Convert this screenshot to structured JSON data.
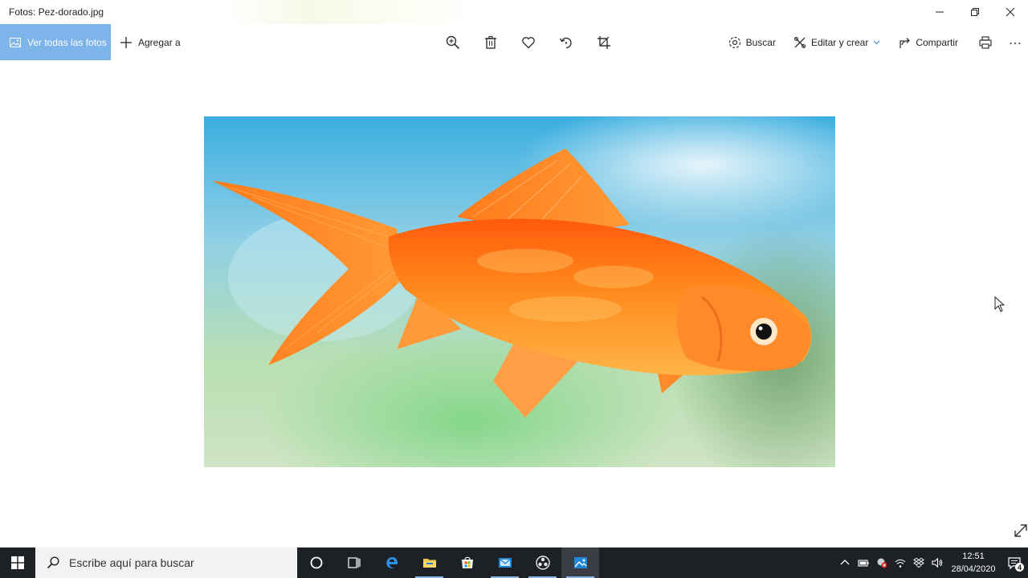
{
  "window": {
    "title": "Fotos: Pez-dorado.jpg",
    "controls": [
      "minimize-icon",
      "maximize-icon",
      "close-icon"
    ]
  },
  "toolbar": {
    "view_all_label": "Ver todas las fotos",
    "add_to_label": "Agregar a",
    "center_tools": [
      "zoom-in-icon",
      "delete-icon",
      "heart-icon",
      "rotate-icon",
      "crop-icon"
    ],
    "search_label": "Buscar",
    "edit_create_label": "Editar y crear",
    "share_label": "Compartir",
    "print_icon": "printer-icon",
    "more_icon": "more-icon"
  },
  "photo": {
    "subject": "goldfish-image",
    "colors": {
      "fish": "#ff6a10",
      "water_top": "#3aaee0",
      "water_bottom": "#a8d8a0"
    }
  },
  "taskbar": {
    "search_placeholder": "Escribe aquí para buscar",
    "apps": [
      "cortana-icon",
      "task-view-icon",
      "edge-icon",
      "file-explorer-icon",
      "store-icon",
      "mail-icon",
      "obs-icon",
      "photos-icon"
    ],
    "tray_icons": [
      "chevron-up-icon",
      "battery-icon",
      "antivirus-icon",
      "network-icon",
      "dropbox-icon",
      "volume-icon"
    ],
    "time": "12:51",
    "date": "28/04/2020",
    "notification_count": "4"
  },
  "colors": {
    "accent": "#7db4ea",
    "taskbar": "#1d2025"
  }
}
